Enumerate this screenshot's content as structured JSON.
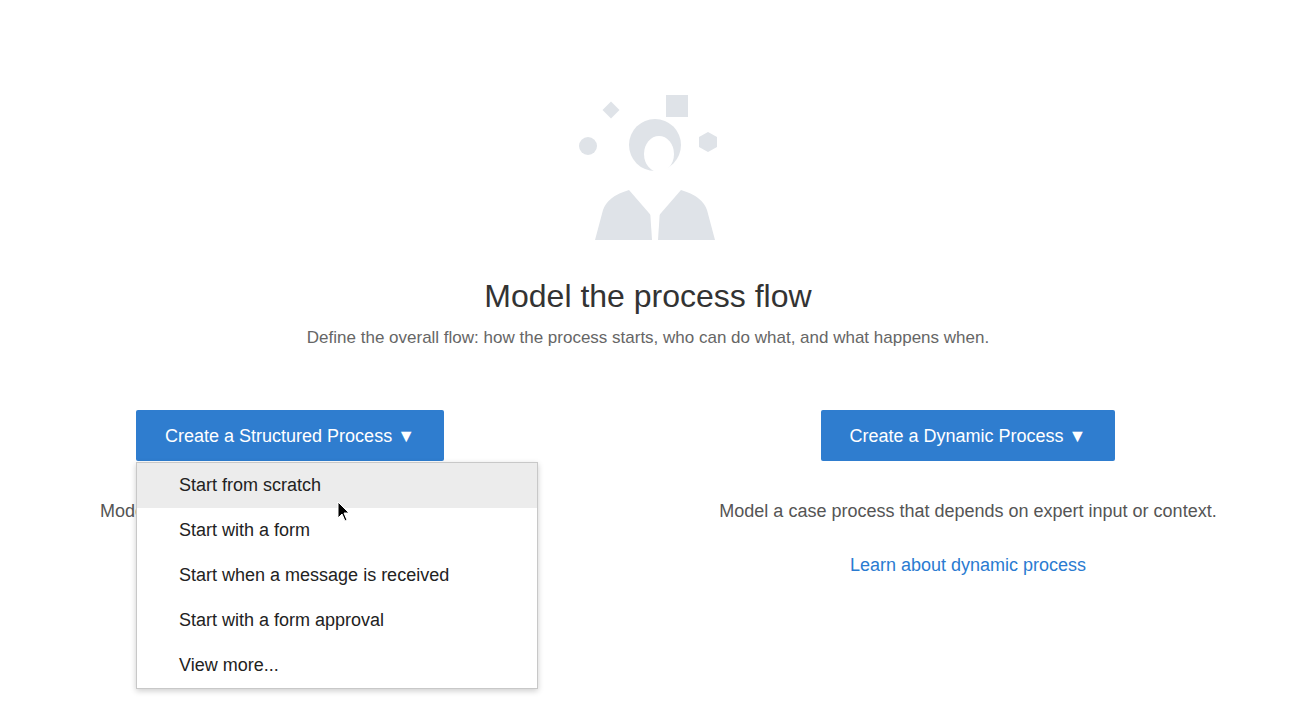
{
  "hero": {
    "title": "Model the process flow",
    "subtitle": "Define the overall flow: how the process starts, who can do what, and what happens when."
  },
  "options": [
    {
      "button": "Create a Structured Process ▼",
      "description": "Model a process that follows a predictable path.",
      "expanded": true,
      "menu": [
        {
          "label": "Start from scratch",
          "selected": true
        },
        {
          "label": "Start with a form",
          "selected": false
        },
        {
          "label": "Start when a message is received",
          "selected": false
        },
        {
          "label": "Start with a form approval",
          "selected": false
        },
        {
          "label": "View more...",
          "selected": false
        }
      ]
    },
    {
      "button": "Create a Dynamic Process ▼",
      "description": "Model a case process that depends on expert input or context.",
      "expanded": false,
      "menu": [],
      "link": "Learn about dynamic process"
    }
  ]
}
